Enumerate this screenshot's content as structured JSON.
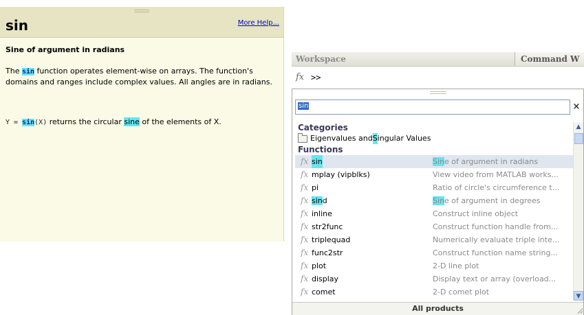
{
  "help": {
    "title": "sin",
    "more_help": "More Help...",
    "subtitle": "Sine of argument in radians",
    "para": {
      "pre": "The ",
      "code": "sin",
      "post": " function operates element-wise on arrays. The function's domains and ranges include complex values. All angles are in radians."
    },
    "syntax": {
      "y": "Y",
      "eq": " = ",
      "fn": "sin",
      "args": "(X)",
      "mid": " returns the circular ",
      "hl": "sine",
      "end": " of the elements of X."
    }
  },
  "tabs": {
    "workspace": "Workspace",
    "command": "Command W"
  },
  "command_line": {
    "fx": "fx",
    "prompt": ">>"
  },
  "browser": {
    "search_value": "sin",
    "clear": "×",
    "categories_label": "Categories",
    "category_item": {
      "pre": "Eigenvalues and ",
      "hl": "S",
      "post": "ingular Values"
    },
    "functions_label": "Functions",
    "functions": [
      {
        "name": "sin",
        "desc": "Sine of argument in radians"
      },
      {
        "name": "mplay (vipblks)",
        "desc": "View video from MATLAB works..."
      },
      {
        "name": "pi",
        "desc": "Ratio of circle's circumference t..."
      },
      {
        "name": "sind",
        "desc": "Sine of argument in degrees"
      },
      {
        "name": "inline",
        "desc": "Construct inline object"
      },
      {
        "name": "str2func",
        "desc": "Construct function handle from..."
      },
      {
        "name": "triplequad",
        "desc": "Numerically evaluate triple inte..."
      },
      {
        "name": "func2str",
        "desc": "Construct function name string..."
      },
      {
        "name": "plot",
        "desc": "2-D line plot"
      },
      {
        "name": "display",
        "desc": "Display text or array (overload..."
      },
      {
        "name": "comet",
        "desc": "2-D comet plot"
      }
    ],
    "footer": "All products",
    "scroll_up": "▲",
    "scroll_down": "▼"
  },
  "colors": {
    "highlight": "#66e6f0",
    "help_bg": "#fafae6",
    "help_header": "#e6e4c3",
    "link": "#0000cc",
    "selection": "#316ac5"
  }
}
